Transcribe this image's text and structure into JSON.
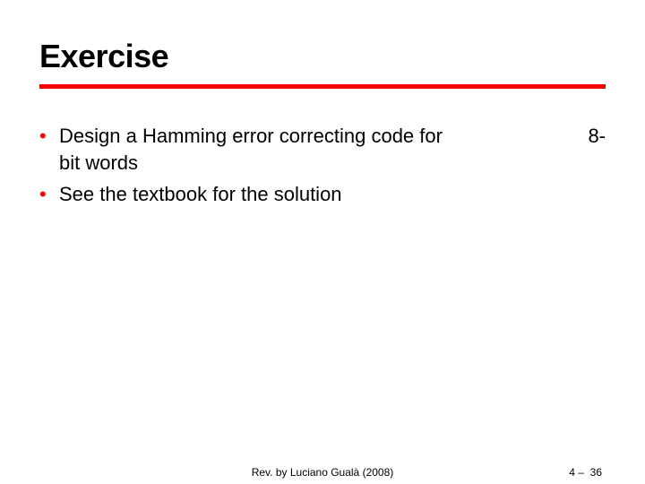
{
  "title": "Exercise",
  "bullets": [
    {
      "text": "Design a Hamming error correcting code for",
      "hang": "8-",
      "cont": "bit words"
    },
    {
      "text": "See the textbook for the solution"
    }
  ],
  "footer": {
    "center": "Rev. by Luciano Gualà (2008)",
    "right": "4 –  36"
  }
}
